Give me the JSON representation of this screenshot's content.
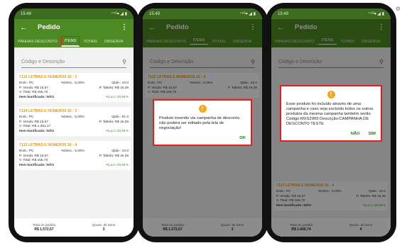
{
  "phones": [
    {
      "status": {
        "time": "15:48",
        "icons": "◉ ▣ •",
        "right": "⁺⁴ᴳ▾ ◢ ▮"
      },
      "appbar": {
        "title": "Pedido",
        "back": "←",
        "menu": "⋮"
      },
      "tabs": [
        "PANHAS DESCONTO",
        "ITENS",
        "TOTAIS",
        "OBSERVA"
      ],
      "search": {
        "placeholder": "Código e Descrição"
      },
      "items": [
        {
          "title": "7132 LETRAS E NÚMEROS 16 - 3",
          "emb": "Emb.: PC",
          "desc": "%Desc.: 5,00%",
          "qtde": "Qtde.: 10.0",
          "pvenda": "P. Venda: R$ 15,57",
          "ptabela": "P. Tabela: R$ 16,39",
          "vtotal": "V. Total: R$ 155,70",
          "bonif": "Item bonificado: NÃO",
          "lucr": "%Lucr.:29,94%"
        },
        {
          "title": "7134 LETRAS E NÚMEROS 16 - 3",
          "emb": "Emb.: PC",
          "desc": "%Desc.: 5,00%",
          "qtde": "Qtde.: 81.0",
          "pvenda": "P. Venda: R$ 15,57",
          "ptabela": "P. Tabela: R$ 16,39",
          "vtotal": "V. Total: R$ 1.261,17",
          "bonif": "Item bonificado: NÃO",
          "lucr": "%Lucr.:29,94%"
        },
        {
          "title": "7132 LETRAS E NÚMEROS 16 - 4",
          "emb": "Emb.: PC",
          "desc": "%Desc.: 5,00%",
          "qtde": "Qtde.: 10.0",
          "pvenda": "P. Venda: R$ 15,57",
          "ptabela": "P. Tabela: R$ 16,39",
          "vtotal": "V. Total: R$ 155,70",
          "bonif": "Item bonificado: NÃO",
          "lucr": "%Lucr.:29,94%"
        }
      ],
      "footer": {
        "total_label": "Total do pedido",
        "total_value": "R$ 1.572,57",
        "qty_label": "Quant. de itens",
        "qty_value": "3"
      }
    },
    {
      "status": {
        "time": "15:49",
        "icons": "◉ ▣ •",
        "right": "⁺⁴ᴳ▾ ◢ ▮"
      },
      "appbar": {
        "title": "Pedido",
        "back": "←",
        "menu": "⋮"
      },
      "tabs": [
        "PANHAS DESCONTO",
        "ITENS",
        "TOTAIS",
        "OBSERVA"
      ],
      "search": {
        "placeholder": "Código e Descrição"
      },
      "item_top": {
        "title": "7132 LETRAS E NÚMEROS 16 - 4",
        "emb": "Emb.: PC",
        "desc": "%Desc.: 5,00%",
        "qtde": "Qtde.: 10.0",
        "pvenda": "P. Venda: R$ 15,57",
        "ptabela": "P. Tabela: R$ 16,39",
        "vtotal": "V. Total: R$ 155,70"
      },
      "dialog": {
        "message": "Produto inserido via campanha de desconto, não poderá ser editado pela tela de negociação!",
        "ok": "OK"
      },
      "footer": {
        "total_label": "Total do pedido",
        "total_value": "R$ 1.572,57",
        "qty_label": "Quant. de itens",
        "qty_value": "3"
      }
    },
    {
      "status": {
        "time": "15:49",
        "icons": "◉ ▣ •",
        "right": "⁺⁴ᴳ▾ ◢ ▮"
      },
      "appbar": {
        "title": "Pedido",
        "back": "←",
        "menu": "⋮"
      },
      "tabs": [
        "PANHAS DESCONTO",
        "ITENS",
        "TOTAIS",
        "OBSERVA"
      ],
      "search": {
        "placeholder": "Código e Descrição"
      },
      "item_bottom": {
        "title": "7132 LETRAS E NÚMEROS 16 - 4",
        "emb": "Emb.: PC",
        "desc": "%Desc.: 5,00%",
        "qtde": "Qtde.: 10.0",
        "pvenda": "P. Venda: R$ 15,57",
        "ptabela": "P. Tabela: R$ 16,39",
        "vtotal": "V. Total: R$ 155,70",
        "bonif": "Item bonificado: NÃO",
        "lucr": "%Lucr.:29,94%"
      },
      "dialog": {
        "message": "Esse produto foi incluído através de uma campanha e caso seja excluído todos os outros produtos da mesma campanha também serão. Código:MXS2909 Descrição:CAMPANHA DE DESCONTO TESTE",
        "no": "NÃO",
        "yes": "SIM"
      },
      "footer": {
        "total_label": "Total do pedido",
        "total_value": "R$ 1.666,74",
        "qty_label": "Quant. de itens",
        "qty_value": "4"
      }
    }
  ]
}
